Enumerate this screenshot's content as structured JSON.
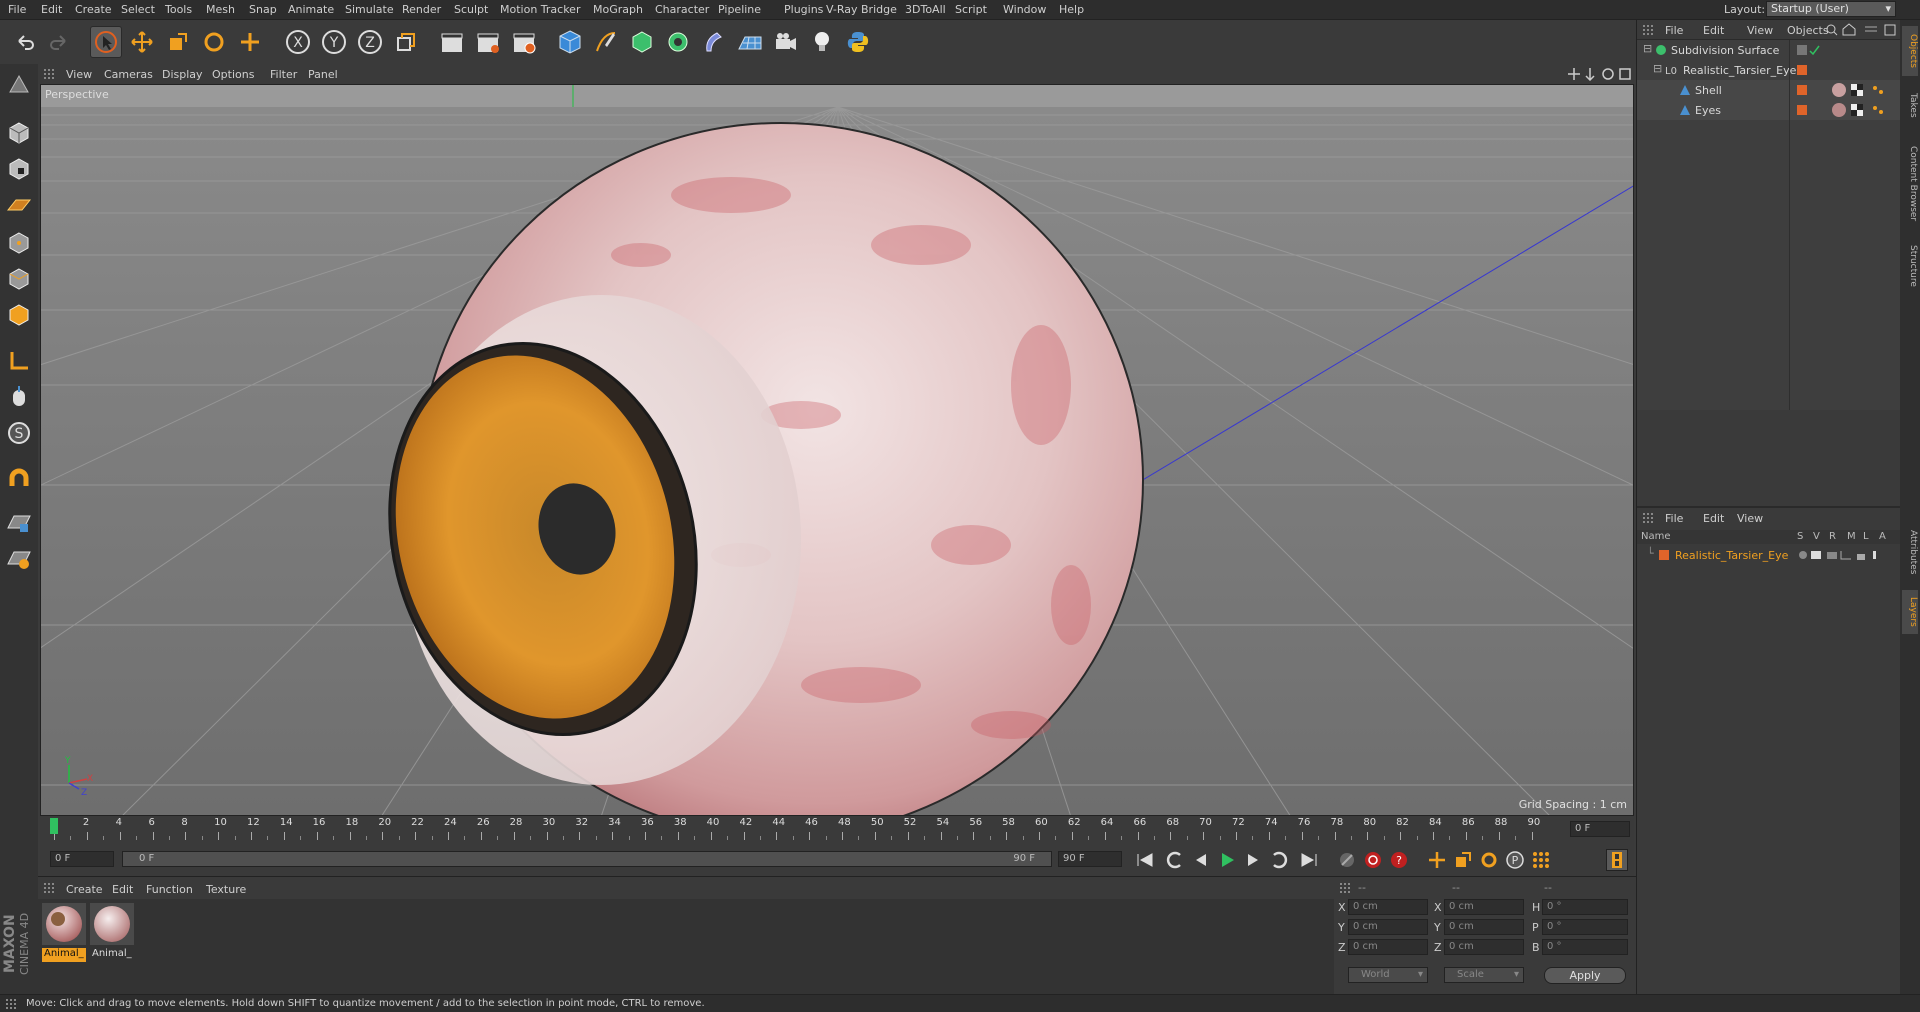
{
  "menu": [
    "File",
    "Edit",
    "Create",
    "Select",
    "Tools",
    "Mesh",
    "Snap",
    "Animate",
    "Simulate",
    "Render",
    "Sculpt",
    "Motion Tracker",
    "MoGraph",
    "Character",
    "Pipeline",
    "Plugins",
    "V-Ray Bridge",
    "3DToAll",
    "Script",
    "Window",
    "Help"
  ],
  "layout": {
    "label": "Layout:",
    "value": "Startup (User)"
  },
  "viewport": {
    "menu": [
      "View",
      "Cameras",
      "Display",
      "Options",
      "Filter",
      "Panel"
    ],
    "label": "Perspective",
    "grid_spacing": "Grid Spacing : 1 cm"
  },
  "timeline": {
    "ticks": [
      "0",
      "2",
      "4",
      "6",
      "8",
      "10",
      "12",
      "14",
      "16",
      "18",
      "20",
      "22",
      "24",
      "26",
      "28",
      "30",
      "32",
      "34",
      "36",
      "38",
      "40",
      "42",
      "44",
      "46",
      "48",
      "50",
      "52",
      "54",
      "56",
      "58",
      "60",
      "62",
      "64",
      "66",
      "68",
      "70",
      "72",
      "74",
      "76",
      "78",
      "80",
      "82",
      "84",
      "86",
      "88",
      "90"
    ],
    "end_frame": "0 F"
  },
  "controls": {
    "current": "0 F",
    "range_start": "0 F",
    "range_end": "90 F",
    "end": "90 F"
  },
  "materials": {
    "menu": [
      "Create",
      "Edit",
      "Function",
      "Texture"
    ],
    "items": [
      "Animal_",
      "Animal_"
    ]
  },
  "coords": {
    "header": [
      "--",
      "--",
      "--"
    ],
    "rows": [
      {
        "a": "X",
        "v1": "0 cm",
        "b": "X",
        "v2": "0 cm",
        "c": "H",
        "v3": "0 °"
      },
      {
        "a": "Y",
        "v1": "0 cm",
        "b": "Y",
        "v2": "0 cm",
        "c": "P",
        "v3": "0 °"
      },
      {
        "a": "Z",
        "v1": "0 cm",
        "b": "Z",
        "v2": "0 cm",
        "c": "B",
        "v3": "0 °"
      }
    ],
    "world": "World",
    "scale": "Scale",
    "apply": "Apply"
  },
  "object_manager": {
    "menu": [
      "File",
      "Edit",
      "View",
      "Objects"
    ],
    "objects": [
      {
        "name": "Subdivision Surface",
        "indent": 0
      },
      {
        "name": "Realistic_Tarsier_Eye",
        "indent": 1
      },
      {
        "name": "Shell",
        "indent": 2
      },
      {
        "name": "Eyes",
        "indent": 2
      }
    ]
  },
  "layer_manager": {
    "menu": [
      "File",
      "Edit",
      "View"
    ],
    "columns": [
      "Name",
      "S",
      "V",
      "R",
      "M",
      "L",
      "A"
    ],
    "layers": [
      {
        "name": "Realistic_Tarsier_Eye",
        "color": "#e0642a"
      }
    ]
  },
  "side_tabs": [
    "Objects",
    "Takes",
    "Content Browser",
    "Structure",
    "Attributes",
    "Layers"
  ],
  "status": "Move: Click and drag to move elements. Hold down SHIFT to quantize movement / add to the selection in point mode, CTRL to remove.",
  "brand": {
    "maxon": "MAXON",
    "product": "CINEMA 4D"
  },
  "colors": {
    "accent": "#e0642a",
    "iris": "#d88a22",
    "highlight": "#f0a020"
  }
}
